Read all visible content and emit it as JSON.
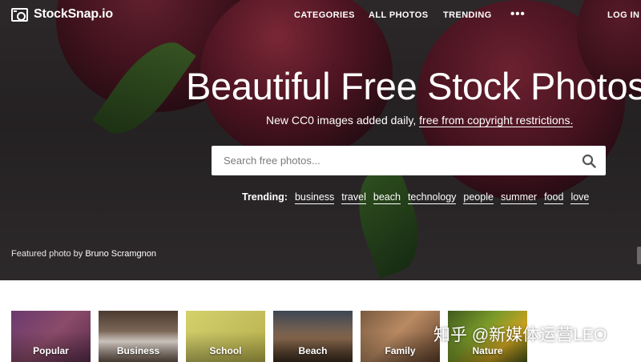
{
  "brand": {
    "name": "StockSnap.io",
    "icon": "camera-icon"
  },
  "nav": {
    "categories": "CATEGORIES",
    "all_photos": "ALL PHOTOS",
    "trending": "TRENDING",
    "more": "•••",
    "login": "LOG IN"
  },
  "hero": {
    "headline": "Beautiful Free Stock Photos",
    "sub_prefix": "New CC0 images added daily, ",
    "sub_link": "free from copyright restrictions.",
    "search": {
      "placeholder": "Search free photos...",
      "icon": "search-icon"
    },
    "trending_label": "Trending:",
    "trending_tags": [
      "business",
      "travel",
      "beach",
      "technology",
      "people",
      "summer",
      "food",
      "love"
    ],
    "credit_prefix": "Featured photo by ",
    "credit_name": "Bruno Scramgnon"
  },
  "categories": [
    {
      "label": "Popular"
    },
    {
      "label": "Business"
    },
    {
      "label": "School"
    },
    {
      "label": "Beach"
    },
    {
      "label": "Family"
    },
    {
      "label": "Nature"
    }
  ],
  "watermark": "知乎 @新媒体运营LEO",
  "colors": {
    "nav_text": "#ffffff",
    "search_bg": "#ffffff",
    "placeholder": "#7a7a7a"
  }
}
